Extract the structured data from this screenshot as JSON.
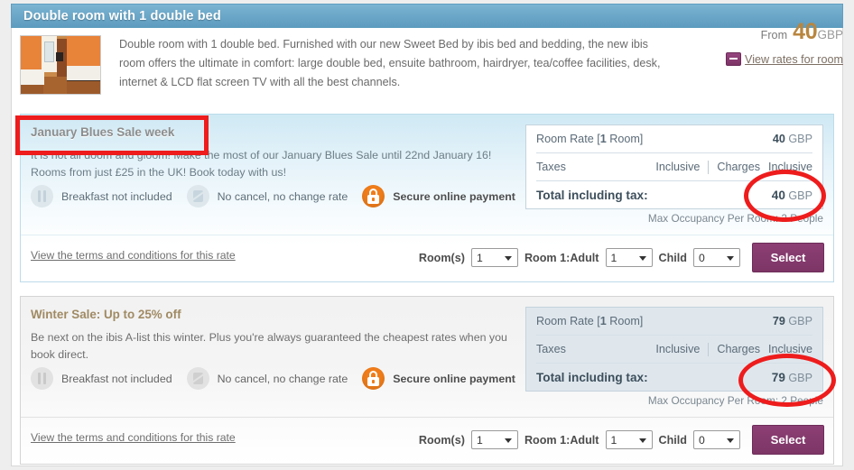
{
  "room": {
    "title": "Double room with 1 double bed",
    "description": "Double room with 1 double bed. Furnished with our new Sweet Bed by ibis bed and bedding, the new ibis room offers the ultimate in comfort: large double bed, ensuite bathroom, hairdryer, tea/coffee facilities, desk, internet & LCD flat screen TV with all the best channels.",
    "thumbnail_alt": "hotel-room-photo"
  },
  "price_summary": {
    "from_label": "From",
    "from_amount": "40",
    "currency": "GBP",
    "view_rates_label": "View rates for room",
    "toggle_icon": "minus-icon"
  },
  "colors": {
    "header_blue": "#6ba7c8",
    "accent_purple": "#7d3566",
    "price_gold": "#b9863f",
    "lock_orange": "#f07d1a",
    "annotation_red": "#ee1c1c"
  },
  "common": {
    "terms_link": "View the terms and conditions for this rate",
    "rooms_label": "Room(s)",
    "adult_label": "Room 1:Adult",
    "child_label": "Child",
    "rooms_value": "1",
    "adult_value": "1",
    "child_value": "0",
    "select_button": "Select",
    "max_occupancy": "Max Occupancy Per Room: 2 People",
    "features": [
      {
        "icon": "meal-icon",
        "label": "Breakfast not included",
        "strong": false
      },
      {
        "icon": "cancel-icon",
        "label": "No cancel, no change rate",
        "strong": false
      },
      {
        "icon": "lock-icon",
        "label": "Secure online payment",
        "strong": true
      }
    ],
    "table_labels": {
      "room_rate": "Room Rate [",
      "room_rate_count": "1",
      "room_rate_suffix": " Room]",
      "taxes": "Taxes",
      "taxes_value": "Inclusive",
      "charges": "Charges",
      "charges_value": "Inclusive",
      "total": "Total including tax:"
    }
  },
  "rates": [
    {
      "offer_title": "January Blues Sale week",
      "offer_desc": "It is not all doom and gloom! Make the most of our January Blues Sale until 22nd January 16! Rooms from just £25 in the UK! Book today with us!",
      "room_rate": "40",
      "room_rate_cur": "GBP",
      "total": "40",
      "total_cur": "GBP",
      "theme": "blue"
    },
    {
      "offer_title": "Winter Sale: Up to 25% off",
      "offer_desc": "Be next on the ibis A-list this winter. Plus you're always guaranteed the cheapest rates when you book direct.",
      "room_rate": "79",
      "room_rate_cur": "GBP",
      "total": "79",
      "total_cur": "GBP",
      "theme": "grey"
    }
  ],
  "annotations": {
    "rect_target": "january-blues-sale-week-title",
    "ellipse_1_target": "total-including-tax-amount-rate-1",
    "ellipse_2_target": "total-including-tax-amount-rate-2"
  }
}
